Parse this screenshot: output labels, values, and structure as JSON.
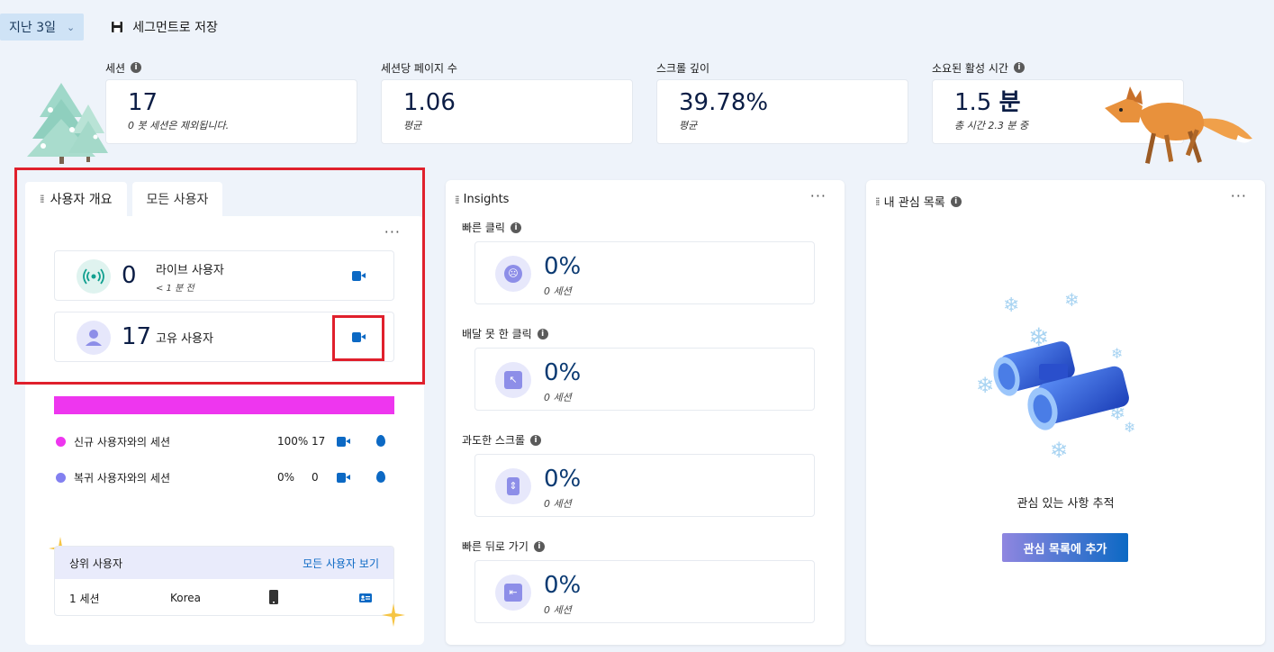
{
  "topbar": {
    "date_range": "지난 3일",
    "save_segment": "세그먼트로 저장"
  },
  "metrics": [
    {
      "label": "세션",
      "value": "17",
      "sub": "0 봇 세션은 제외됩니다."
    },
    {
      "label": "세션당 페이지 수",
      "value": "1.06",
      "sub": "평균"
    },
    {
      "label": "스크롤 깊이",
      "value": "39.78%",
      "sub": "평균"
    },
    {
      "label": "소요된 활성 시간",
      "value": "1.5",
      "unit": "분",
      "sub": "총 시간 2.3 분 중"
    }
  ],
  "users_panel": {
    "tabs": [
      "사용자 개요",
      "모든 사용자"
    ],
    "live": {
      "count": "0",
      "label": "라이브 사용자",
      "sub": "< 1 분 전"
    },
    "unique": {
      "count": "17",
      "label": "고유 사용자"
    },
    "legend": [
      {
        "label": "신규 사용자와의 세션",
        "pct": "100%",
        "count": "17",
        "color": "#ee36ef"
      },
      {
        "label": "복귀 사용자와의 세션",
        "pct": "0%",
        "count": "0",
        "color": "#8380f0"
      }
    ],
    "top_users": {
      "title": "상위 사용자",
      "link": "모든 사용자 보기",
      "rows": [
        {
          "sessions": "1 세션",
          "country": "Korea"
        }
      ]
    }
  },
  "insights": {
    "title": "Insights",
    "items": [
      {
        "label": "빠른 클릭",
        "value": "0%",
        "sub": "0 세션",
        "icon": "angry-face-icon"
      },
      {
        "label": "배달 못 한 클릭",
        "value": "0%",
        "sub": "0 세션",
        "icon": "dead-click-icon"
      },
      {
        "label": "과도한 스크롤",
        "value": "0%",
        "sub": "0 세션",
        "icon": "scroll-icon"
      },
      {
        "label": "빠른 뒤로 가기",
        "value": "0%",
        "sub": "0 세션",
        "icon": "back-icon"
      }
    ]
  },
  "watchlist": {
    "title": "내 관심 목록",
    "empty_text": "관심 있는 사항 추적",
    "button": "관심 목록에 추가"
  },
  "colors": {
    "accent": "#0c69c4",
    "bar": "#ee36ef",
    "highlight": "#e0202c"
  }
}
